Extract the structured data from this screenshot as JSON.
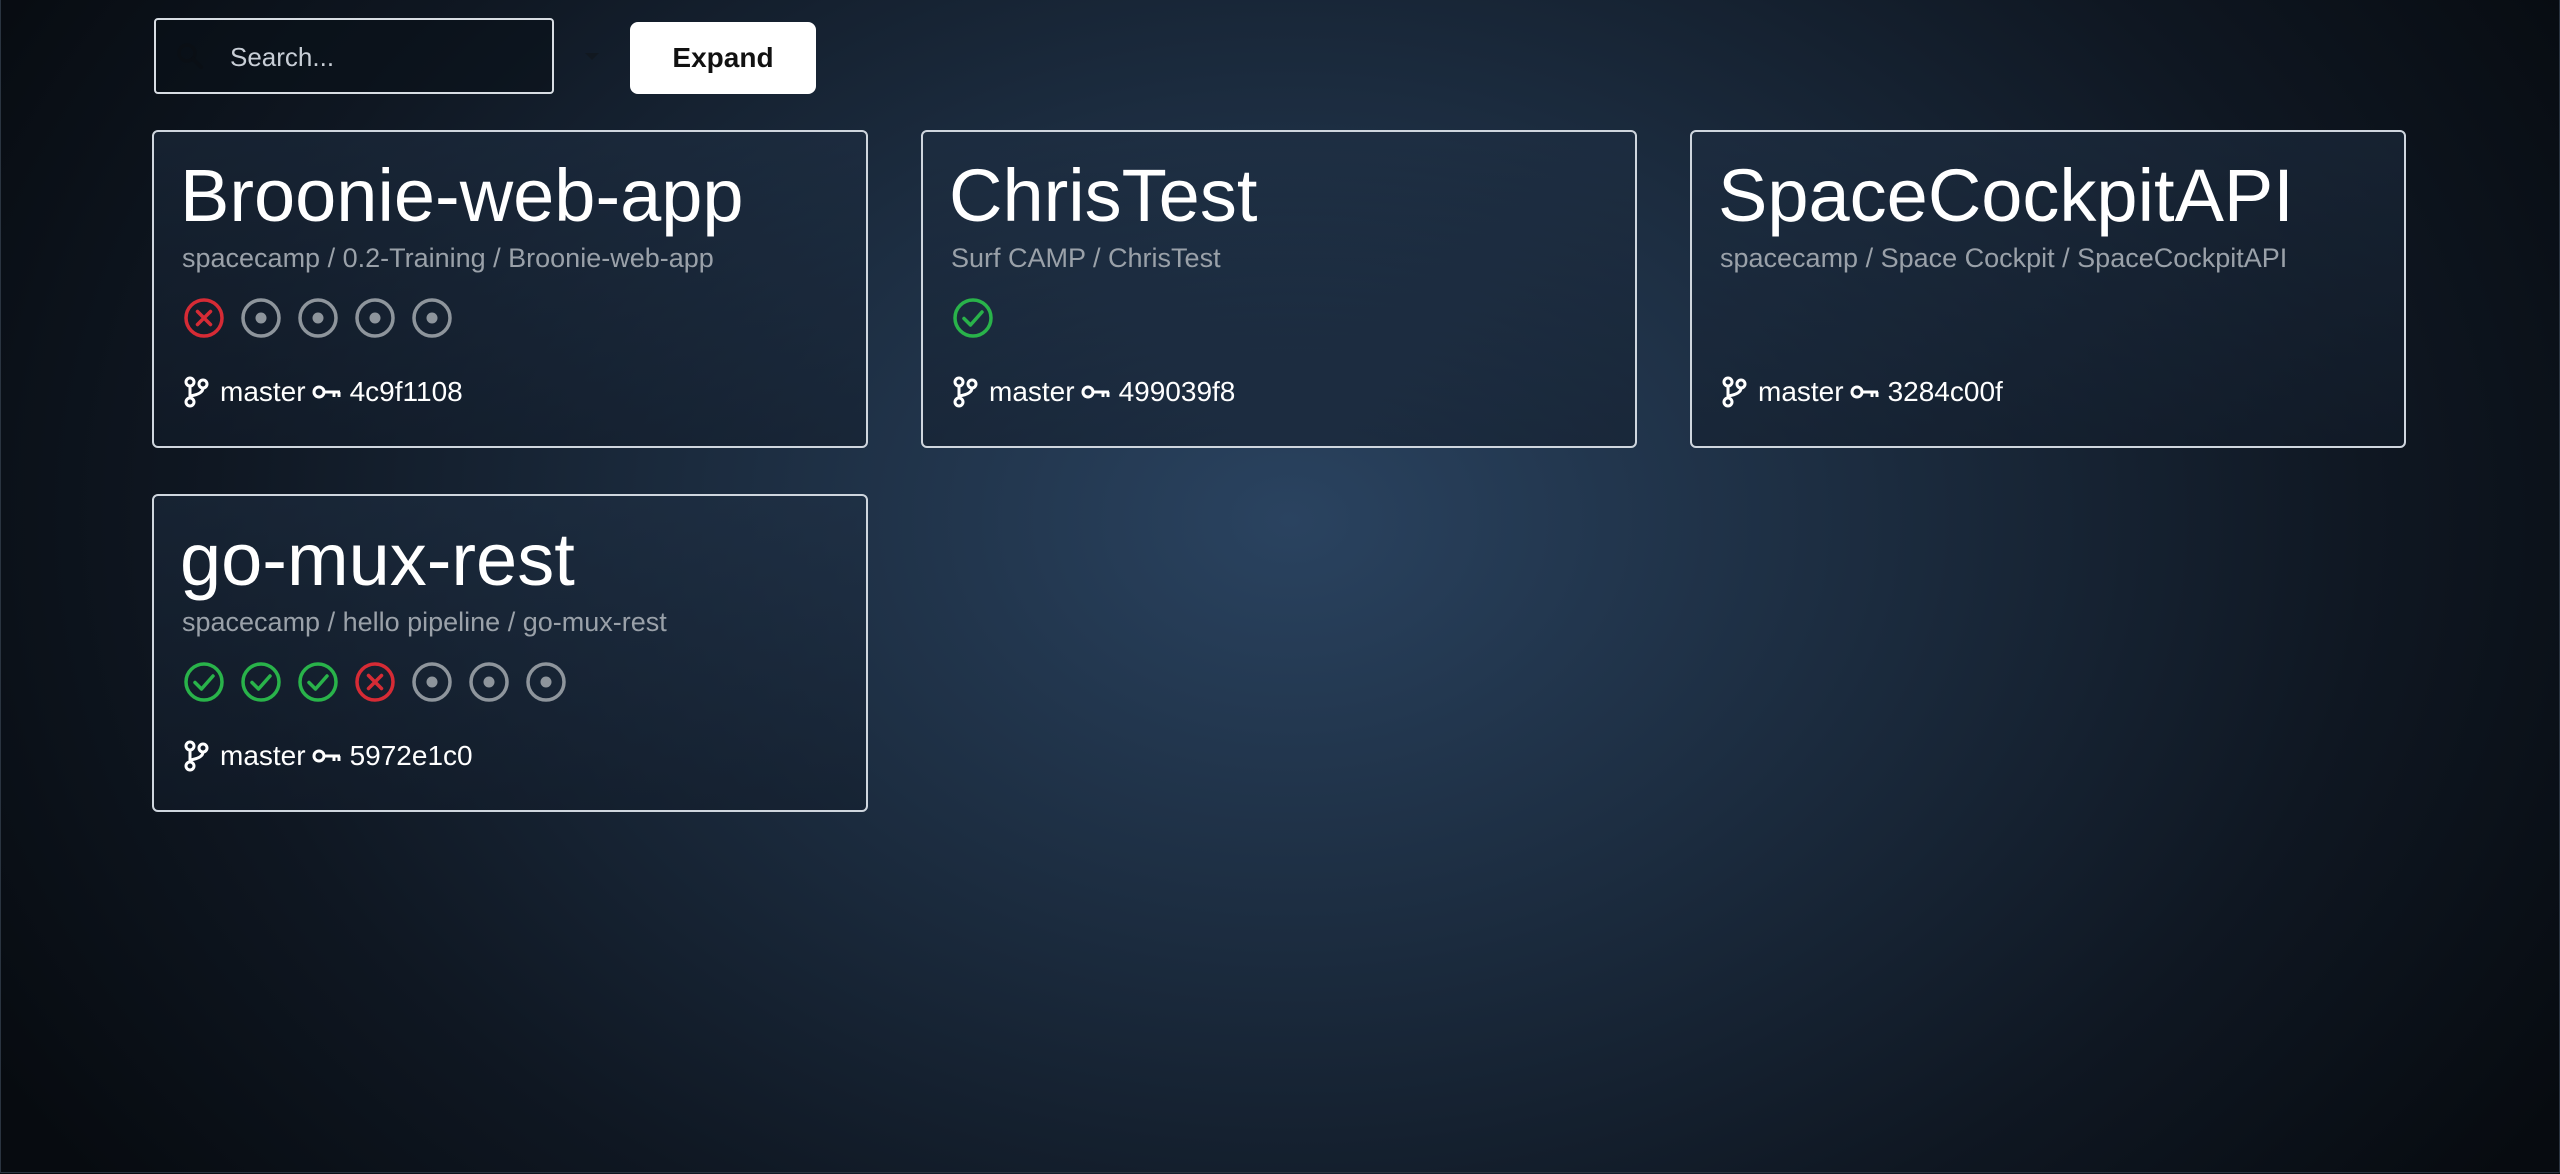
{
  "search": {
    "placeholder": "Search...",
    "value": ""
  },
  "toolbar": {
    "expand_label": "Expand"
  },
  "colors": {
    "success": "#29b34a",
    "failure": "#d62b35",
    "pending": "#8e959c"
  },
  "cards": [
    {
      "title": "Broonie-web-app",
      "path": "spacecamp / 0.2-Training / Broonie-web-app",
      "stages": [
        "failure",
        "pending",
        "pending",
        "pending",
        "pending"
      ],
      "branch": "master",
      "commit": "4c9f1108"
    },
    {
      "title": "ChrisTest",
      "path": "Surf CAMP / ChrisTest",
      "stages": [
        "success"
      ],
      "branch": "master",
      "commit": "499039f8"
    },
    {
      "title": "SpaceCockpitAPI",
      "path": "spacecamp / Space Cockpit / SpaceCockpitAPI",
      "stages": [],
      "branch": "master",
      "commit": "3284c00f"
    },
    {
      "title": "go-mux-rest",
      "path": "spacecamp / hello pipeline / go-mux-rest",
      "stages": [
        "success",
        "success",
        "success",
        "failure",
        "pending",
        "pending",
        "pending"
      ],
      "branch": "master",
      "commit": "5972e1c0"
    }
  ]
}
